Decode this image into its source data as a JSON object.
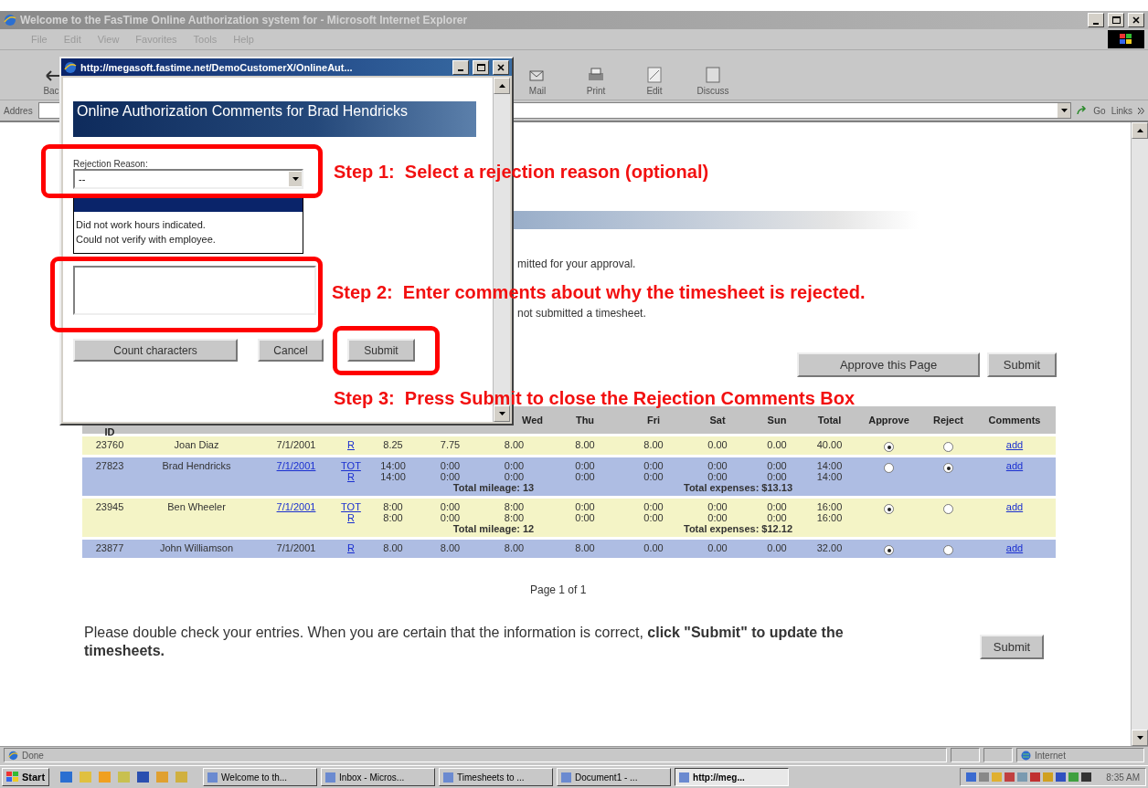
{
  "window": {
    "title": "Welcome to the FasTime Online Authorization system for - Microsoft Internet Explorer"
  },
  "menu": [
    "File",
    "Edit",
    "View",
    "Favorites",
    "Tools",
    "Help"
  ],
  "toolbar": [
    {
      "label": "Bac",
      "kind": "back"
    },
    {
      "label": "Mail",
      "kind": "mail"
    },
    {
      "label": "Print",
      "kind": "print"
    },
    {
      "label": "Edit",
      "kind": "edit"
    },
    {
      "label": "Discuss",
      "kind": "discuss"
    }
  ],
  "address_bar": {
    "label": "Addres",
    "go": "Go",
    "links": "Links"
  },
  "page": {
    "intro_lines": [
      "mitted for your approval.",
      "not submitted a timesheet."
    ],
    "top_buttons": [
      "Approve this Page",
      "Submit"
    ],
    "table": {
      "columns": [
        "ID",
        "Wed",
        "Thu",
        "Fri",
        "Sat",
        "Sun",
        "Total",
        "Approve",
        "Reject",
        "Comments"
      ],
      "rows": [
        {
          "id": "23760",
          "name": "Joan Diaz",
          "date": "7/1/2001",
          "date_link": false,
          "types": [
            "R"
          ],
          "lines": [
            [
              "8.25",
              "7.75",
              "8.00",
              "8.00",
              "8.00",
              "0.00",
              "0.00",
              "40.00"
            ]
          ],
          "mileage": null,
          "expenses": null,
          "approve": true,
          "reject": false,
          "comment": "add",
          "color": "#f4f4c6"
        },
        {
          "id": "27823",
          "name": "Brad Hendricks",
          "date": "7/1/2001",
          "date_link": true,
          "types": [
            "TOT",
            "R"
          ],
          "lines": [
            [
              "14:00",
              "0:00",
              "0:00",
              "0:00",
              "0:00",
              "0:00",
              "0:00",
              "14:00"
            ],
            [
              "14:00",
              "0:00",
              "0:00",
              "0:00",
              "0:00",
              "0:00",
              "0:00",
              "14:00"
            ]
          ],
          "mileage": "Total mileage: 13",
          "expenses": "Total expenses: $13.13",
          "approve": false,
          "reject": true,
          "comment": "add",
          "color": "#aebde3"
        },
        {
          "id": "23945",
          "name": "Ben Wheeler",
          "date": "7/1/2001",
          "date_link": true,
          "types": [
            "TOT",
            "R"
          ],
          "lines": [
            [
              "8:00",
              "0:00",
              "8:00",
              "0:00",
              "0:00",
              "0:00",
              "0:00",
              "16:00"
            ],
            [
              "8:00",
              "0:00",
              "8:00",
              "0:00",
              "0:00",
              "0:00",
              "0:00",
              "16:00"
            ]
          ],
          "mileage": "Total mileage: 12",
          "expenses": "Total expenses: $12.12",
          "approve": true,
          "reject": false,
          "comment": "add",
          "color": "#f4f4c6"
        },
        {
          "id": "23877",
          "name": "John Williamson",
          "date": "7/1/2001",
          "date_link": false,
          "types": [
            "R"
          ],
          "lines": [
            [
              "8.00",
              "8.00",
              "8.00",
              "8.00",
              "0.00",
              "0.00",
              "0.00",
              "32.00"
            ]
          ],
          "mileage": null,
          "expenses": null,
          "approve": true,
          "reject": false,
          "comment": "add",
          "color": "#aebde3"
        }
      ]
    },
    "pager": "Page 1 of 1",
    "notice": "Please double check your entries. When you are certain that the information is correct, **click \"Submit\" to update the timesheets.**",
    "bottom_button": "Submit"
  },
  "popup": {
    "title": "http://megasoft.fastime.net/DemoCustomerX/OnlineAut...",
    "heading": "Online Authorization Comments for Brad Hendricks",
    "reason_label": "Rejection Reason:",
    "reason_value": "--",
    "options": [
      "Did not work hours indicated.",
      "Could not verify with employee."
    ],
    "buttons": [
      "Count characters",
      "Cancel",
      "Submit"
    ]
  },
  "annotations": [
    "Step 1:  Select a rejection reason (optional)",
    "Step 2:  Enter comments about why the timesheet is rejected.",
    "Step 3:  Press Submit to close the Rejection Comments Box"
  ],
  "status_bar": {
    "text": "Done",
    "zone": "Internet"
  },
  "taskbar": {
    "start": "Start",
    "tasks": [
      {
        "label": "Welcome to th...",
        "selected": false
      },
      {
        "label": "Inbox - Micros...",
        "selected": false
      },
      {
        "label": "Timesheets to ...",
        "selected": false
      },
      {
        "label": "Document1 - ...",
        "selected": false
      },
      {
        "label": "http://meg...",
        "selected": true
      }
    ],
    "clock": "8:35 AM"
  }
}
